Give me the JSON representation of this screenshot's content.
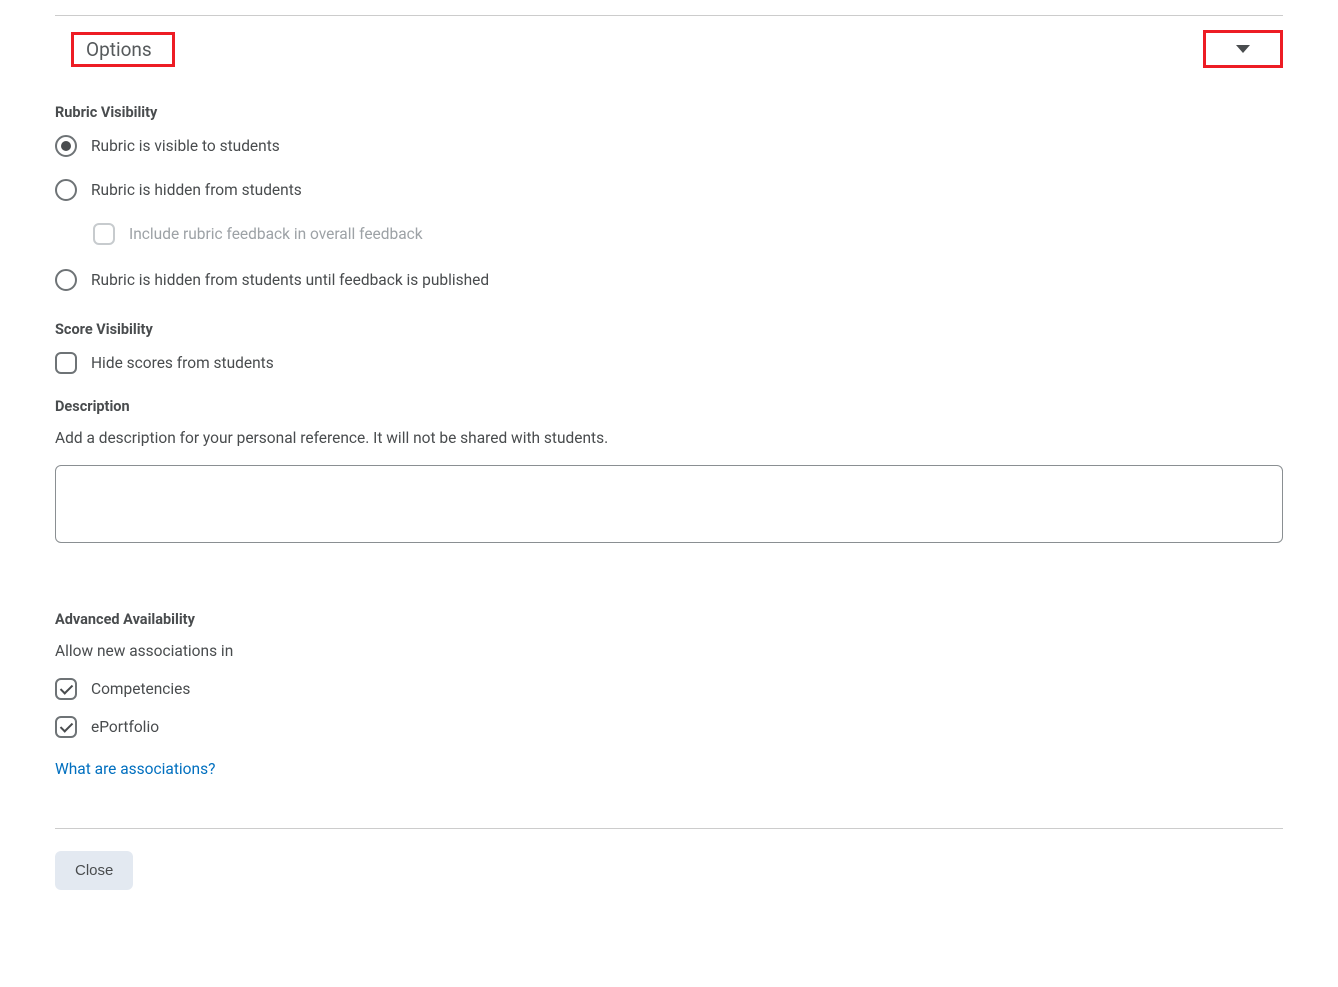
{
  "header": {
    "title": "Options"
  },
  "rubricVisibility": {
    "title": "Rubric Visibility",
    "options": {
      "visible": "Rubric is visible to students",
      "hidden": "Rubric is hidden from students",
      "includeFeedback": "Include rubric feedback in overall feedback",
      "hiddenUntilPublished": "Rubric is hidden from students until feedback is published"
    }
  },
  "scoreVisibility": {
    "title": "Score Visibility",
    "hideScores": "Hide scores from students"
  },
  "description": {
    "title": "Description",
    "help": "Add a description for your personal reference. It will not be shared with students.",
    "value": ""
  },
  "advancedAvailability": {
    "title": "Advanced Availability",
    "subtitle": "Allow new associations in",
    "competencies": "Competencies",
    "eportfolio": "ePortfolio",
    "link": "What are associations?"
  },
  "footer": {
    "close": "Close"
  }
}
